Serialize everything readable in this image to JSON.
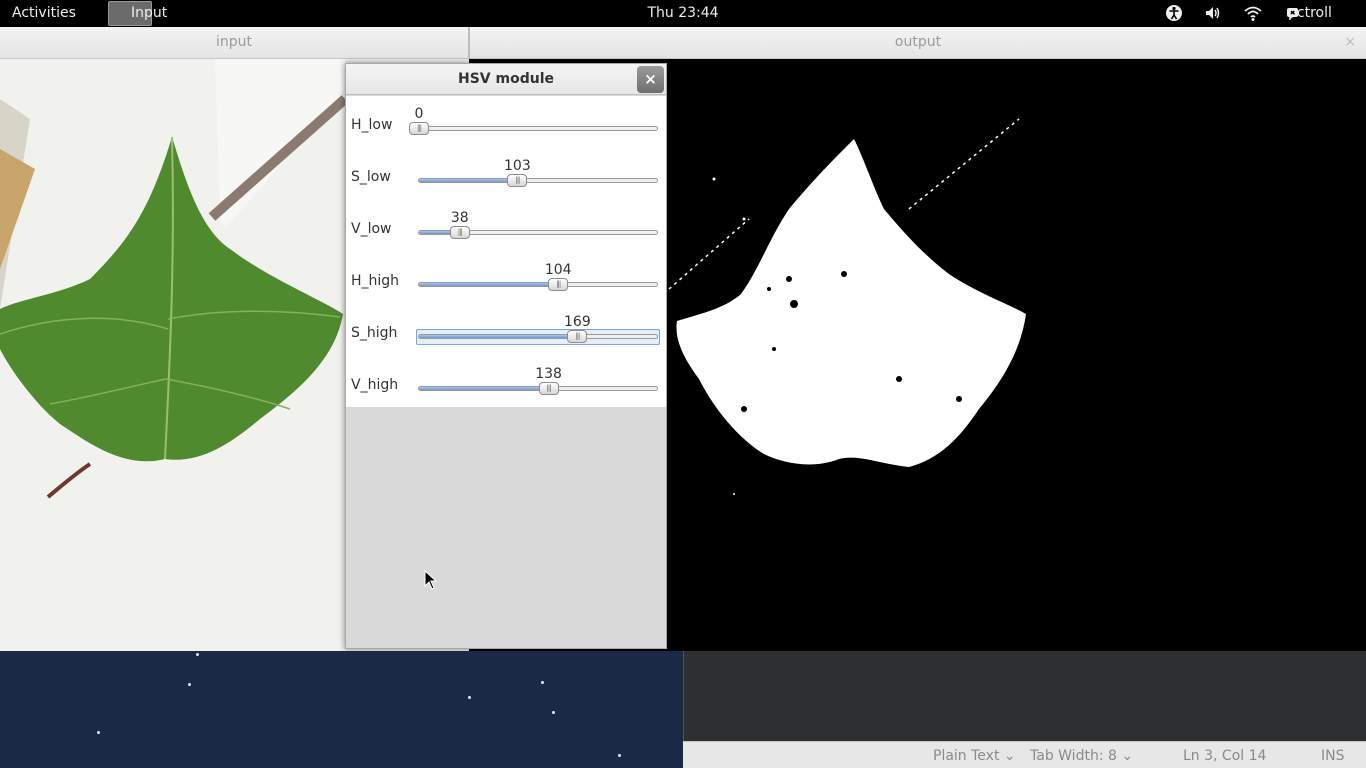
{
  "topbar": {
    "activities": "Activities",
    "app_name": "Input",
    "clock": "Thu 23:44",
    "user": "pctroll",
    "icons": [
      "accessibility-icon",
      "volume-icon",
      "wifi-icon",
      "chat-icon"
    ]
  },
  "windows": {
    "input_title": "input",
    "output_title": "output",
    "output_close": "×"
  },
  "dialog": {
    "title": "HSV module",
    "close": "×",
    "sliders": [
      {
        "label": "H_low",
        "value": "0",
        "fraction": 0.0
      },
      {
        "label": "S_low",
        "value": "103",
        "fraction": 0.41
      },
      {
        "label": "V_low",
        "value": "38",
        "fraction": 0.17
      },
      {
        "label": "H_high",
        "value": "104",
        "fraction": 0.58
      },
      {
        "label": "S_high",
        "value": "169",
        "fraction": 0.66
      },
      {
        "label": "V_high",
        "value": "138",
        "fraction": 0.54
      }
    ]
  },
  "editor_status": {
    "language": "Plain Text",
    "tab_width": "Tab Width:  8",
    "position": "Ln 3, Col 14",
    "mode": "INS"
  },
  "colors": {
    "leaf_green": "#5a8a32",
    "slider_fill": "#7fa3d6",
    "desktop_blue": "#1a2a46"
  }
}
